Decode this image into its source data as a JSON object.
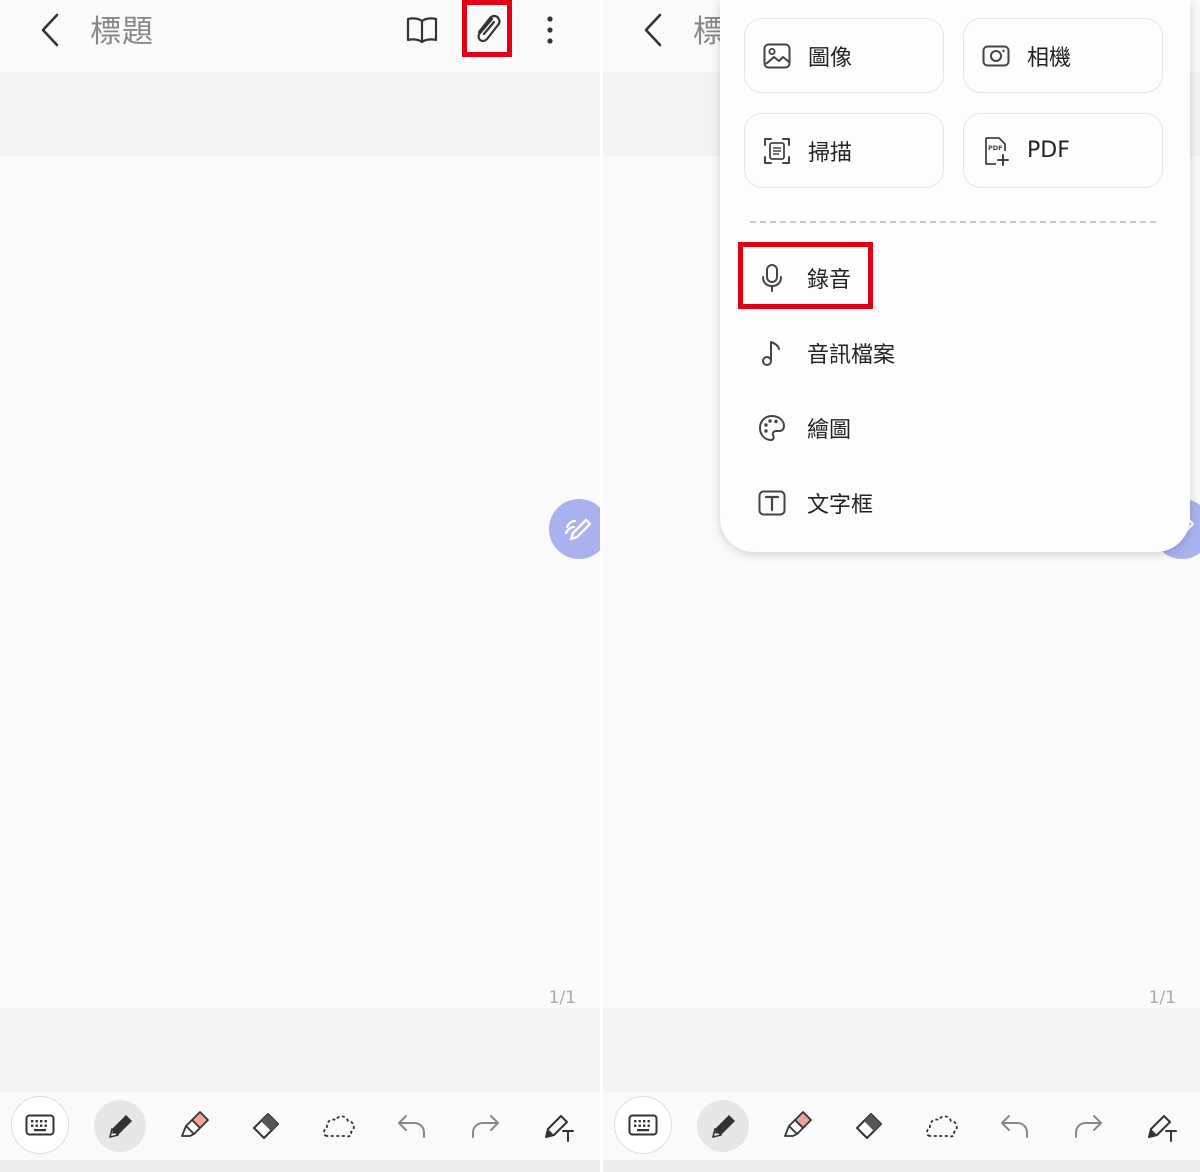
{
  "note": {
    "title": "標題",
    "page_indicator": "1/1"
  },
  "attach_menu": {
    "grid": [
      {
        "label": "圖像",
        "icon": "image-icon"
      },
      {
        "label": "相機",
        "icon": "camera-icon"
      },
      {
        "label": "掃描",
        "icon": "scan-icon"
      },
      {
        "label": "PDF",
        "icon": "pdf-add-icon"
      }
    ],
    "list": [
      {
        "label": "錄音",
        "icon": "microphone-icon"
      },
      {
        "label": "音訊檔案",
        "icon": "music-note-icon"
      },
      {
        "label": "繪圖",
        "icon": "palette-icon"
      },
      {
        "label": "文字框",
        "icon": "text-box-icon"
      }
    ]
  },
  "toolbar_icons": [
    "keyboard-icon",
    "pen-icon",
    "highlighter-icon",
    "eraser-icon",
    "lasso-icon",
    "undo-icon",
    "redo-icon",
    "pen-to-text-icon"
  ],
  "colors": {
    "highlight": "#e20012",
    "fab": "#a9b1ef",
    "highlighter_tip": "#f0a39a"
  }
}
